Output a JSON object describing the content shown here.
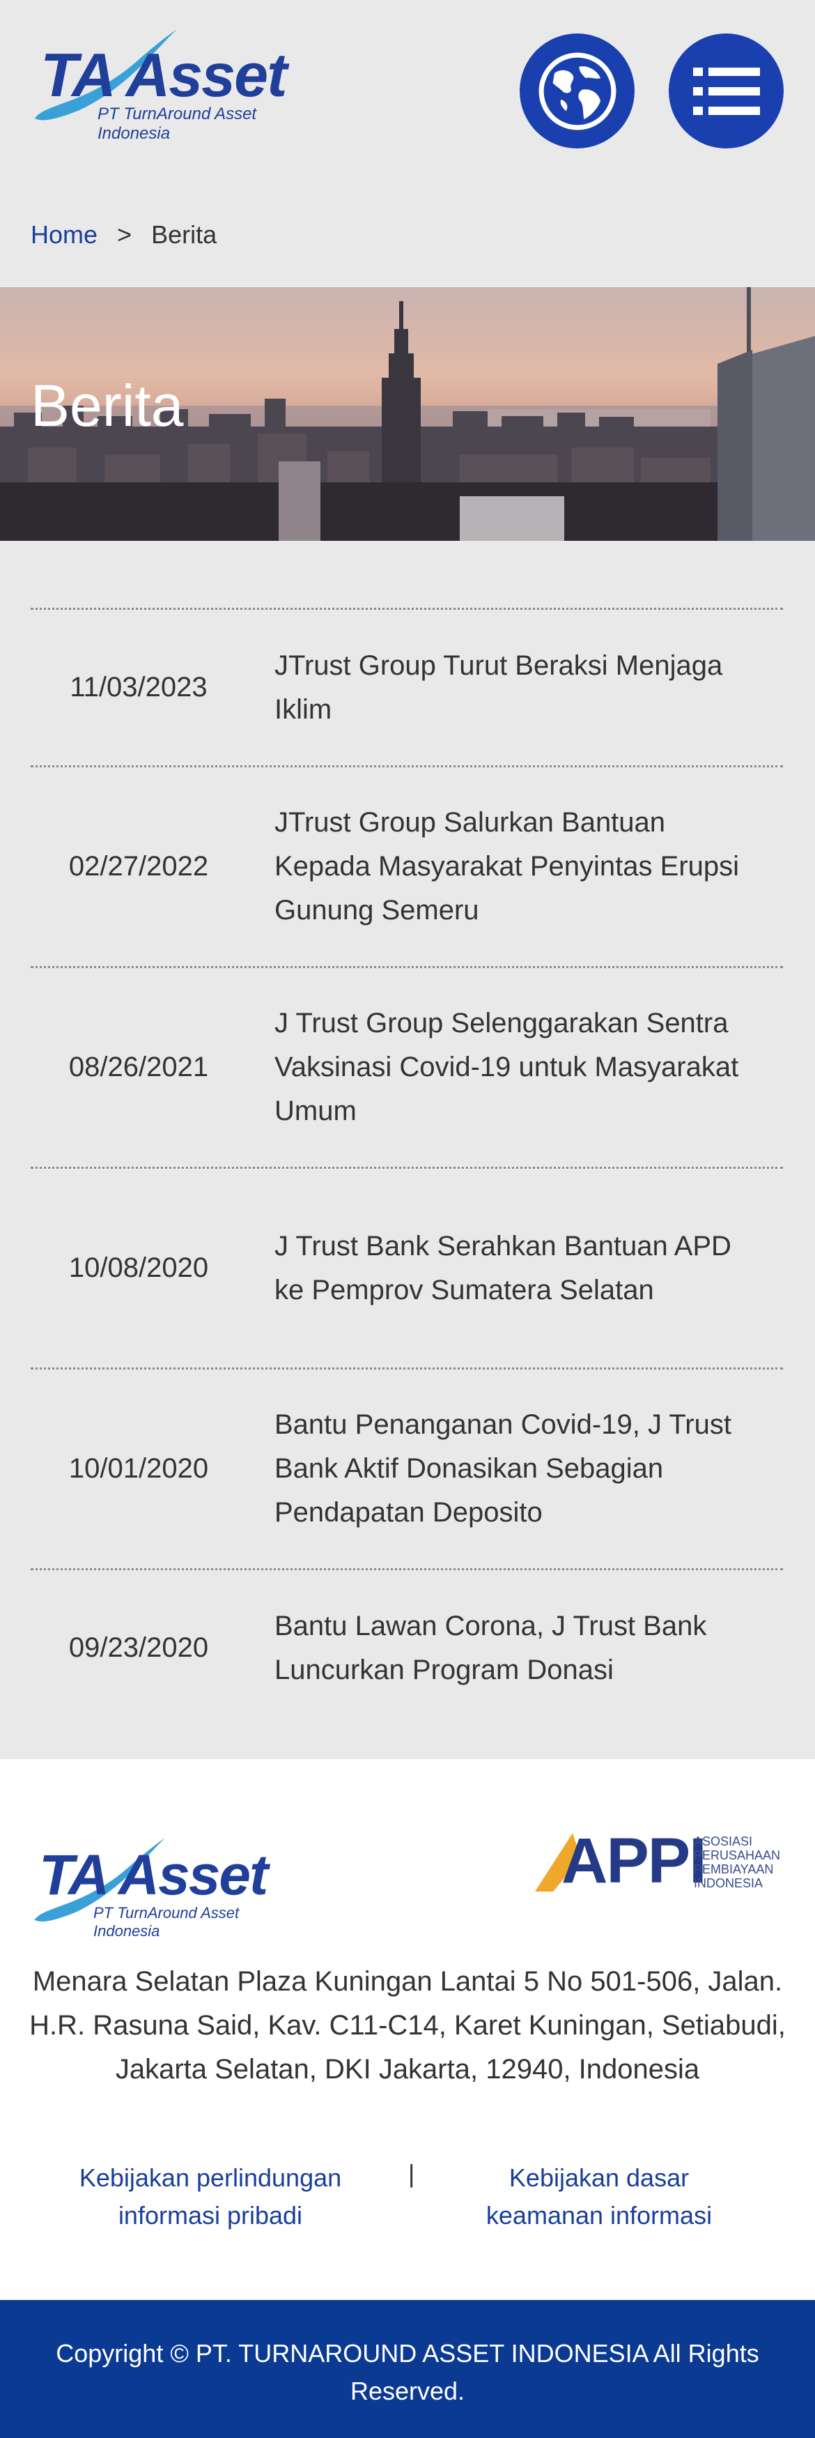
{
  "header": {
    "logo": {
      "brand": "TA Asset",
      "tagline": "PT TurnAround Asset Indonesia"
    },
    "icons": {
      "language": "globe-icon",
      "menu": "menu-list-icon"
    },
    "accent_color": "#1a40b0"
  },
  "breadcrumb": {
    "home": "Home",
    "separator": ">",
    "current": "Berita"
  },
  "hero": {
    "title": "Berita"
  },
  "news": [
    {
      "date": "11/03/2023",
      "title": "JTrust Group Turut Beraksi Menjaga Iklim"
    },
    {
      "date": "02/27/2022",
      "title": "JTrust Group Salurkan Bantuan Kepada Masyarakat Penyintas Erupsi Gunung Semeru"
    },
    {
      "date": "08/26/2021",
      "title": "J Trust Group Selenggarakan Sentra Vaksinasi Covid-19 untuk Masyarakat Umum"
    },
    {
      "date": "10/08/2020",
      "title": "J Trust Bank Serahkan Bantuan APD ke Pemprov Sumatera Selatan"
    },
    {
      "date": "10/01/2020",
      "title": "Bantu Penanganan Covid-19, J Trust Bank Aktif Donasikan Sebagian Pendapatan Deposito"
    },
    {
      "date": "09/23/2020",
      "title": "Bantu Lawan Corona, J Trust Bank Luncurkan Program Donasi"
    }
  ],
  "footer": {
    "logo": {
      "brand": "TA Asset",
      "tagline": "PT TurnAround Asset Indonesia"
    },
    "appi": {
      "letters": "APPI",
      "line1": "ASOSIASI",
      "line2": "PERUSAHAAN",
      "line3": "PEMBIAYAAN",
      "line4": "INDONESIA"
    },
    "address": "Menara Selatan Plaza Kuningan Lantai 5 No 501-506, Jalan. H.R. Rasuna Said, Kav. C11-C14, Karet Kuningan, Setiabudi, Jakarta Selatan, DKI Jakarta, 12940, Indonesia",
    "policy_privacy": "Kebijakan perlindungan informasi pribadi",
    "policy_divider": "|",
    "policy_security": "Kebijakan dasar keamanan informasi",
    "copyright": "Copyright © PT. TURNAROUND ASSET INDONESIA All Rights Reserved."
  }
}
